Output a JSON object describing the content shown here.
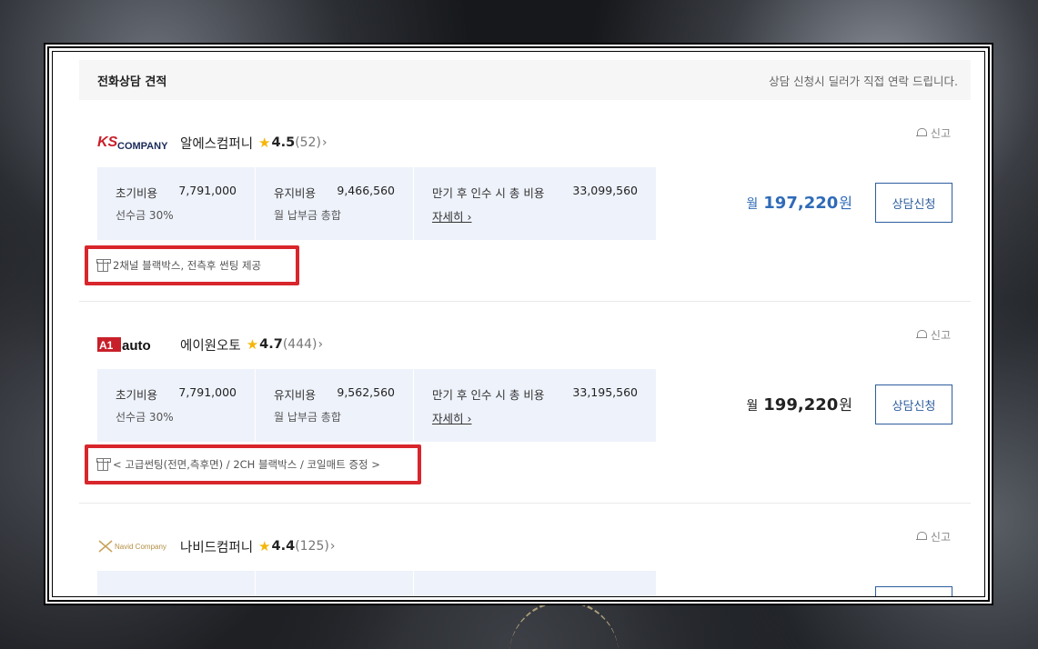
{
  "header": {
    "title": "전화상담 견적",
    "note": "상담 신청시 딜러가 직접 연락 드립니다."
  },
  "colors": {
    "accent_blue": "#2f6bb8",
    "button_border": "#2d5d9e",
    "cost_bg": "#eef2fb",
    "highlight_red": "#d8262c",
    "star": "#f5b50a"
  },
  "dealers": [
    {
      "logo_text": "COMPANY",
      "logo_mark": "KS",
      "name": "알에스컴퍼니",
      "rating": "4.5",
      "reviews": "(52)",
      "report": "신고",
      "initial_label": "초기비용",
      "initial_value": "7,791,000",
      "deposit": "선수금 30%",
      "maint_label": "유지비용",
      "maint_value": "9,466,560",
      "maint_sub": "월 납부금 총합",
      "total_label": "만기 후 인수 시 총 비용",
      "total_value": "33,099,560",
      "detail": "자세히",
      "price_pre": "월",
      "price": "197,220",
      "price_post": "원",
      "apply": "상담신청",
      "gift": "2채널 블랙박스, 전측후 썬팅 제공"
    },
    {
      "logo_text": "A1auto",
      "name": "에이원오토",
      "rating": "4.7",
      "reviews": "(444)",
      "report": "신고",
      "initial_label": "초기비용",
      "initial_value": "7,791,000",
      "deposit": "선수금 30%",
      "maint_label": "유지비용",
      "maint_value": "9,562,560",
      "maint_sub": "월 납부금 총합",
      "total_label": "만기 후 인수 시 총 비용",
      "total_value": "33,195,560",
      "detail": "자세히",
      "price_pre": "월",
      "price": "199,220",
      "price_post": "원",
      "apply": "상담신청",
      "gift": "< 고급썬팅(전면,측후면) / 2CH 블랙박스 / 코일매트 증정 >"
    },
    {
      "logo_text": "Navid Company",
      "name": "나비드컴퍼니",
      "rating": "4.4",
      "reviews": "(125)",
      "report": "신고"
    }
  ]
}
